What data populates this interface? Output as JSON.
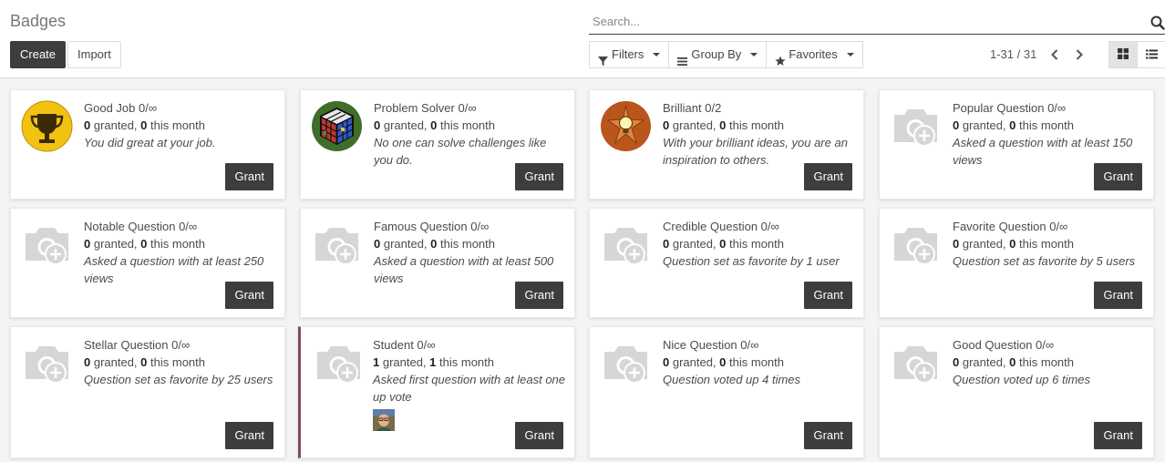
{
  "page": {
    "title": "Badges"
  },
  "toolbar": {
    "create_label": "Create",
    "import_label": "Import"
  },
  "search": {
    "placeholder": "Search..."
  },
  "filters": {
    "filters_label": "Filters",
    "group_by_label": "Group By",
    "favorites_label": "Favorites"
  },
  "pager": {
    "value": "1-31 / 31"
  },
  "icons": {
    "search": "search-icon",
    "filter": "filter-icon",
    "group_by": "bars-icon",
    "favorites": "star-icon",
    "prev": "chevron-left-icon",
    "next": "chevron-right-icon",
    "kanban_view": "th-large-icon",
    "list_view": "list-icon"
  },
  "colors": {
    "primary_button": "#3d3d3d",
    "highlight_border": "#7c4a66"
  },
  "badges": [
    {
      "title": "Good Job 0/∞",
      "granted": "0",
      "this_month": "0",
      "granted_label": " granted, ",
      "month_label": " this month",
      "description": "You did great at your job.",
      "image": "trophy",
      "grant_label": "Grant"
    },
    {
      "title": "Problem Solver 0/∞",
      "granted": "0",
      "this_month": "0",
      "granted_label": " granted, ",
      "month_label": " this month",
      "description": "No one can solve challenges like you do.",
      "image": "rubik-cube",
      "grant_label": "Grant"
    },
    {
      "title": "Brilliant 0/2",
      "granted": "0",
      "this_month": "0",
      "granted_label": " granted, ",
      "month_label": " this month",
      "description": "With your brilliant ideas, you are an inspiration to others.",
      "image": "lightbulb",
      "grant_label": "Grant"
    },
    {
      "title": "Popular Question 0/∞",
      "granted": "0",
      "this_month": "0",
      "granted_label": " granted, ",
      "month_label": " this month",
      "description": "Asked a question with at least 150 views",
      "image": "camera-placeholder",
      "grant_label": "Grant"
    },
    {
      "title": "Notable Question 0/∞",
      "granted": "0",
      "this_month": "0",
      "granted_label": " granted, ",
      "month_label": " this month",
      "description": "Asked a question with at least 250 views",
      "image": "camera-placeholder",
      "grant_label": "Grant"
    },
    {
      "title": "Famous Question 0/∞",
      "granted": "0",
      "this_month": "0",
      "granted_label": " granted, ",
      "month_label": " this month",
      "description": "Asked a question with at least 500 views",
      "image": "camera-placeholder",
      "grant_label": "Grant"
    },
    {
      "title": "Credible Question 0/∞",
      "granted": "0",
      "this_month": "0",
      "granted_label": " granted, ",
      "month_label": " this month",
      "description": "Question set as favorite by 1 user",
      "image": "camera-placeholder",
      "grant_label": "Grant"
    },
    {
      "title": "Favorite Question 0/∞",
      "granted": "0",
      "this_month": "0",
      "granted_label": " granted, ",
      "month_label": " this month",
      "description": "Question set as favorite by 5 users",
      "image": "camera-placeholder",
      "grant_label": "Grant"
    },
    {
      "title": "Stellar Question 0/∞",
      "granted": "0",
      "this_month": "0",
      "granted_label": " granted, ",
      "month_label": " this month",
      "description": "Question set as favorite by 25 users",
      "image": "camera-placeholder",
      "grant_label": "Grant"
    },
    {
      "title": "Student 0/∞",
      "granted": "1",
      "this_month": "1",
      "granted_label": " granted, ",
      "month_label": " this month",
      "description": "Asked first question with at least one up vote",
      "image": "camera-placeholder",
      "grant_label": "Grant",
      "has_holder": true
    },
    {
      "title": "Nice Question 0/∞",
      "granted": "0",
      "this_month": "0",
      "granted_label": " granted, ",
      "month_label": " this month",
      "description": "Question voted up 4 times",
      "image": "camera-placeholder",
      "grant_label": "Grant"
    },
    {
      "title": "Good Question 0/∞",
      "granted": "0",
      "this_month": "0",
      "granted_label": " granted, ",
      "month_label": " this month",
      "description": "Question voted up 6 times",
      "image": "camera-placeholder",
      "grant_label": "Grant"
    }
  ]
}
